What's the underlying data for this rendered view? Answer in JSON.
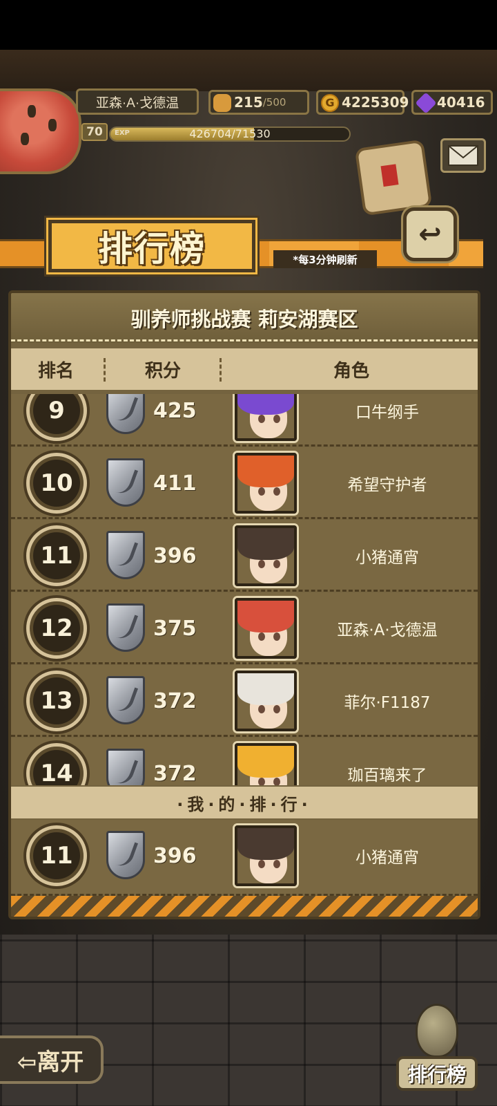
{
  "player": {
    "name": "亚森·A·戈德温",
    "level": "70",
    "exp_tag": "EXP",
    "exp_text": "426704/71530",
    "exp_progress": 0.6
  },
  "resources": {
    "bread": "215",
    "bread_max": "/500",
    "gold": "4225309",
    "gold_icon": "G",
    "gems": "40416"
  },
  "banner": {
    "title": "排行榜",
    "note": "*每3分钟刷新",
    "back_icon": "↩"
  },
  "panel": {
    "title": "驯养师挑战赛 莉安湖赛区",
    "columns": [
      "排名",
      "积分",
      "角色"
    ],
    "rows": [
      {
        "rank": "9",
        "score": "425",
        "name": "口牛纲手",
        "hair": "#7a4ad0"
      },
      {
        "rank": "10",
        "score": "411",
        "name": "希望守护者",
        "hair": "#e0602a"
      },
      {
        "rank": "11",
        "score": "396",
        "name": "小猪通宵",
        "hair": "#4a3a30"
      },
      {
        "rank": "12",
        "score": "375",
        "name": "亚森·A·戈德温",
        "hair": "#d8503c"
      },
      {
        "rank": "13",
        "score": "372",
        "name": "菲尔·F1187",
        "hair": "#e8e4dc"
      },
      {
        "rank": "14",
        "score": "372",
        "name": "珈百璃来了",
        "hair": "#f0b030"
      }
    ],
    "my_rank_header": "·我·的·排·行·",
    "mine": {
      "rank": "11",
      "score": "396",
      "name": "小猪通宵",
      "hair": "#4a3a30"
    }
  },
  "buttons": {
    "leave": "⇦离开",
    "ranking": "排行榜"
  }
}
